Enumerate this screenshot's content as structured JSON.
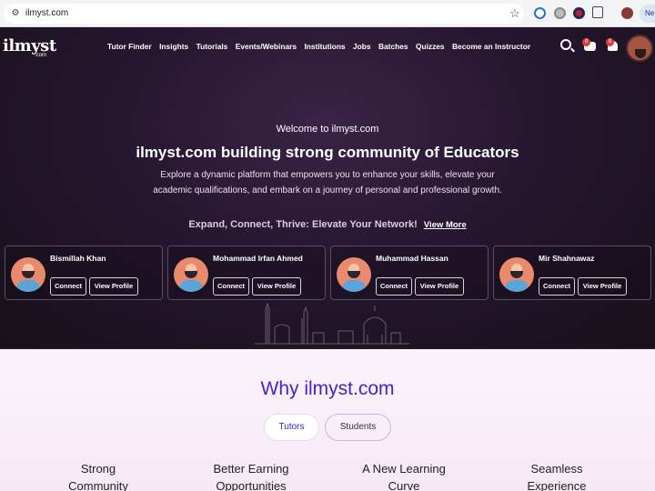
{
  "browser": {
    "url": "ilmyst.com",
    "new_tab_label": "Ne"
  },
  "site": {
    "logo": "ilmyst",
    "logo_sub": ".com",
    "nav": [
      "Tutor Finder",
      "Insights",
      "Tutorials",
      "Events/Webinars",
      "Institutions",
      "Jobs",
      "Batches",
      "Quizzes",
      "Become an Instructor"
    ],
    "badges": {
      "messages": "0",
      "notifications": "0"
    }
  },
  "hero": {
    "kicker": "Welcome to ilmyst.com",
    "title": "ilmyst.com building strong community of Educators",
    "description": "Explore a dynamic platform that empowers you to enhance your skills, elevate your academic qualifications, and embark on a journey of personal and professional growth.",
    "tagline": "Expand, Connect, Thrive: Elevate Your Network!",
    "view_more": "View More"
  },
  "profiles": [
    {
      "name": "Bismillah Khan",
      "connect": "Connect",
      "view": "View Profile"
    },
    {
      "name": "Mohammad Irfan Ahmed",
      "connect": "Connect",
      "view": "View Profile"
    },
    {
      "name": "Muhammad Hassan",
      "connect": "Connect",
      "view": "View Profile"
    },
    {
      "name": "Mir Shahnawaz",
      "connect": "Connect",
      "view": "View Profile"
    }
  ],
  "why": {
    "title": "Why ilmyst.com",
    "tabs": [
      "Tutors",
      "Students"
    ],
    "features": [
      [
        "Strong",
        "Community"
      ],
      [
        "Better Earning",
        "Opportunities"
      ],
      [
        "A New Learning",
        "Curve"
      ],
      [
        "Seamless",
        "Experience"
      ]
    ]
  },
  "colors": {
    "hero_bg": "#26162f",
    "accent": "#4a20c9",
    "badge": "#e23b3b"
  }
}
